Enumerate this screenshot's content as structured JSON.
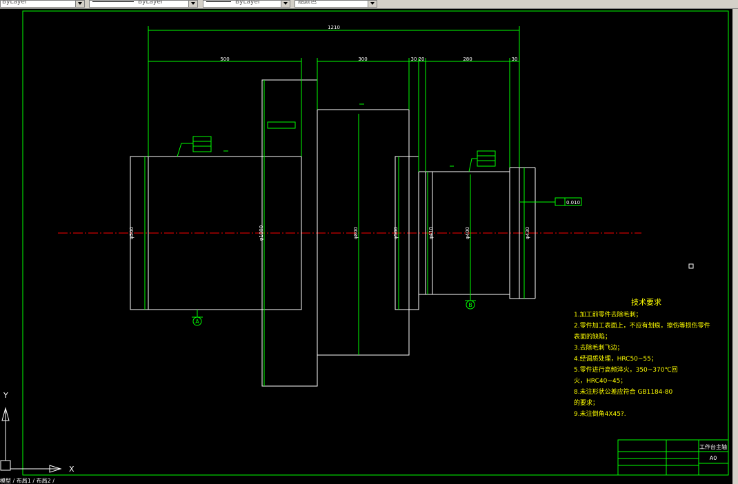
{
  "toolbar": {
    "layer_dropdown": "ByLayer",
    "linetype_dropdown": "ByLayer",
    "lineweight_dropdown": "ByLayer",
    "color_dropdown": "随颜色"
  },
  "dimensions": {
    "total_length": "1210",
    "seg_500": "500",
    "seg_300": "300",
    "seg_30a": "30",
    "seg_20": "20",
    "seg_280": "280",
    "seg_30b": "30",
    "d_500": "φ500",
    "d_1000": "φ1000",
    "d_800": "φ800",
    "d_500b": "φ500",
    "d_410": "φ410",
    "d_400": "φ400",
    "d_430": "φ430",
    "flatness": "0.010"
  },
  "datums": {
    "a": "A",
    "b": "B"
  },
  "tech_requirements": {
    "title": "技术要求",
    "items": [
      "1.加工前零件去除毛刺；",
      "2.零件加工表面上，不应有划痕，擦伤等损伤零件",
      "  表面的缺陷；",
      "3.去除毛刺飞边；",
      "4.经调质处理，HRC50~55；",
      "5.零件进行高频淬火，350~370℃回",
      "  火，HRC40~45；",
      "8.未注形状公差应符合 GB1184-80",
      "  的要求；",
      "9.未注倒角4X45?."
    ]
  },
  "title_block": {
    "name": "工作台主轴",
    "size": "A0"
  },
  "ucs": {
    "x_label": "X",
    "y_label": "Y"
  },
  "command_line": "模型 / 布局1 / 布局2 /"
}
